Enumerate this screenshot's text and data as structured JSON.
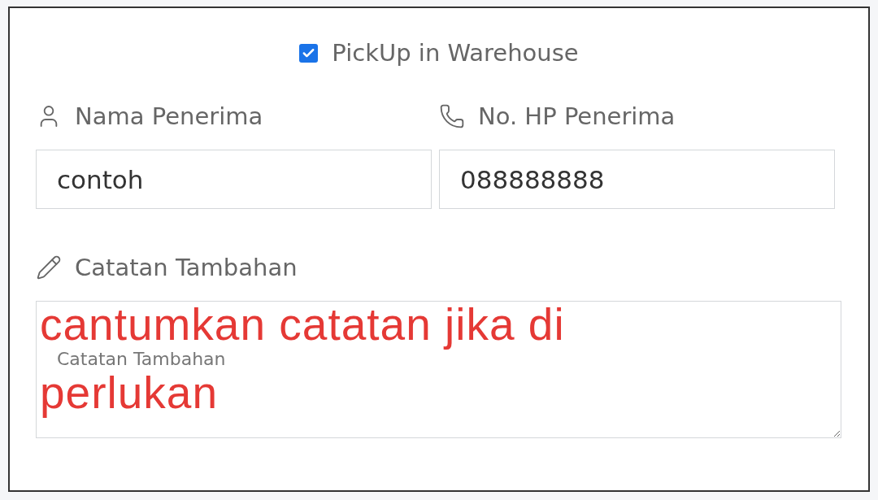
{
  "pickup_checkbox": {
    "label": "PickUp in Warehouse",
    "checked": true
  },
  "fields": [
    {
      "kind": "name",
      "label": "Nama Penerima",
      "value": "contoh"
    },
    {
      "kind": "phone",
      "label": "No. HP Penerima",
      "value": "088888888"
    }
  ],
  "notes": {
    "kind": "note",
    "label": "Catatan Tambahan",
    "placeholder": "Catatan Tambahan"
  },
  "annotation": {
    "lines": [
      "cantumkan catatan jika di",
      "perlukan"
    ]
  }
}
